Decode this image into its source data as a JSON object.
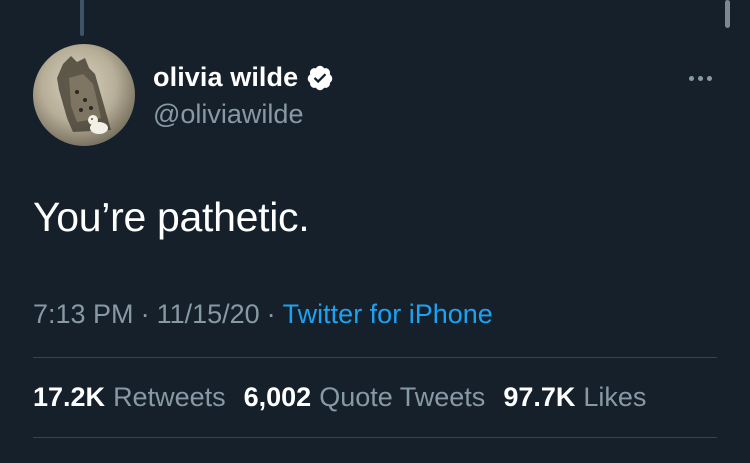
{
  "tweet": {
    "display_name": "olivia wilde",
    "handle": "@oliviawilde",
    "text": "You’re pathetic.",
    "time": "7:13 PM",
    "date": "11/15/20",
    "separator": "·",
    "source": "Twitter for iPhone",
    "stats": [
      {
        "count": "17.2K",
        "label": "Retweets"
      },
      {
        "count": "6,002",
        "label": "Quote Tweets"
      },
      {
        "count": "97.7K",
        "label": "Likes"
      }
    ]
  },
  "icons": {
    "verified": "verified-badge-icon",
    "more": "more-horizontal-icon"
  },
  "colors": {
    "background": "#15202b",
    "text_primary": "#ffffff",
    "text_secondary": "#8899a6",
    "link": "#1da1f2",
    "divider": "#38444d"
  }
}
